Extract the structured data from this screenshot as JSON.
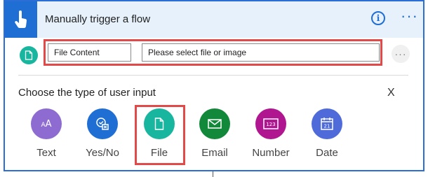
{
  "header": {
    "title": "Manually trigger a flow",
    "info_glyph": "i",
    "more_glyph": "···"
  },
  "input_row": {
    "field_name_value": "File Content",
    "field_description_value": "Please select file or image",
    "more_glyph": "···"
  },
  "input_types": {
    "heading": "Choose the type of user input",
    "close_label": "X",
    "options": [
      {
        "label": "Text",
        "color": "#8e6bd1",
        "icon": "text-icon"
      },
      {
        "label": "Yes/No",
        "color": "#1f6ed4",
        "icon": "yes-no-icon"
      },
      {
        "label": "File",
        "color": "#18b59f",
        "icon": "file-icon",
        "highlighted": true
      },
      {
        "label": "Email",
        "color": "#12883b",
        "icon": "email-icon"
      },
      {
        "label": "Number",
        "color": "#b0168f",
        "icon": "number-icon"
      },
      {
        "label": "Date",
        "color": "#4f6bd9",
        "icon": "date-icon"
      }
    ]
  },
  "colors": {
    "accent": "#1f6ed4",
    "header_bg": "#e6f1fb",
    "highlight": "#e24a4a"
  }
}
